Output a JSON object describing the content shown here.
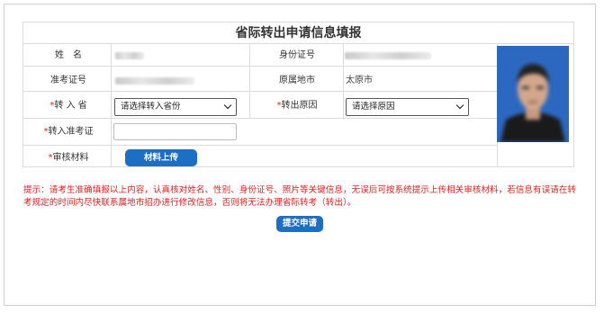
{
  "form": {
    "title": "省际转出申请信息填报",
    "labels": {
      "name": "姓　名",
      "exam_number": "准考证号",
      "id_number": "身份证号",
      "origin_city": "原属地市",
      "transfer_province": "转 入 省",
      "transfer_reason": "转出原因",
      "transfer_exam_number": "转入准考证",
      "review_materials": "审核材料"
    },
    "required_mark": "*",
    "values": {
      "origin_city": "太原市"
    },
    "province_select": {
      "selected": "请选择转入省份"
    },
    "reason_select": {
      "selected": "请选择原因"
    },
    "upload_button": "材料上传"
  },
  "tip": "提示：请考生准确填报以上内容，认真核对姓名、性别、身份证号、照片等关键信息，无误后可按系统提示上传相关审核材料，若信息有误请在转考规定的时间内尽快联系属地市招办进行修改信息，否则将无法办理省际转考（转出）。",
  "submit_button": "提交申请",
  "colors": {
    "accent": "#1d6fc4",
    "warning_text": "#e02020",
    "photo_background": "#2c68c0"
  }
}
